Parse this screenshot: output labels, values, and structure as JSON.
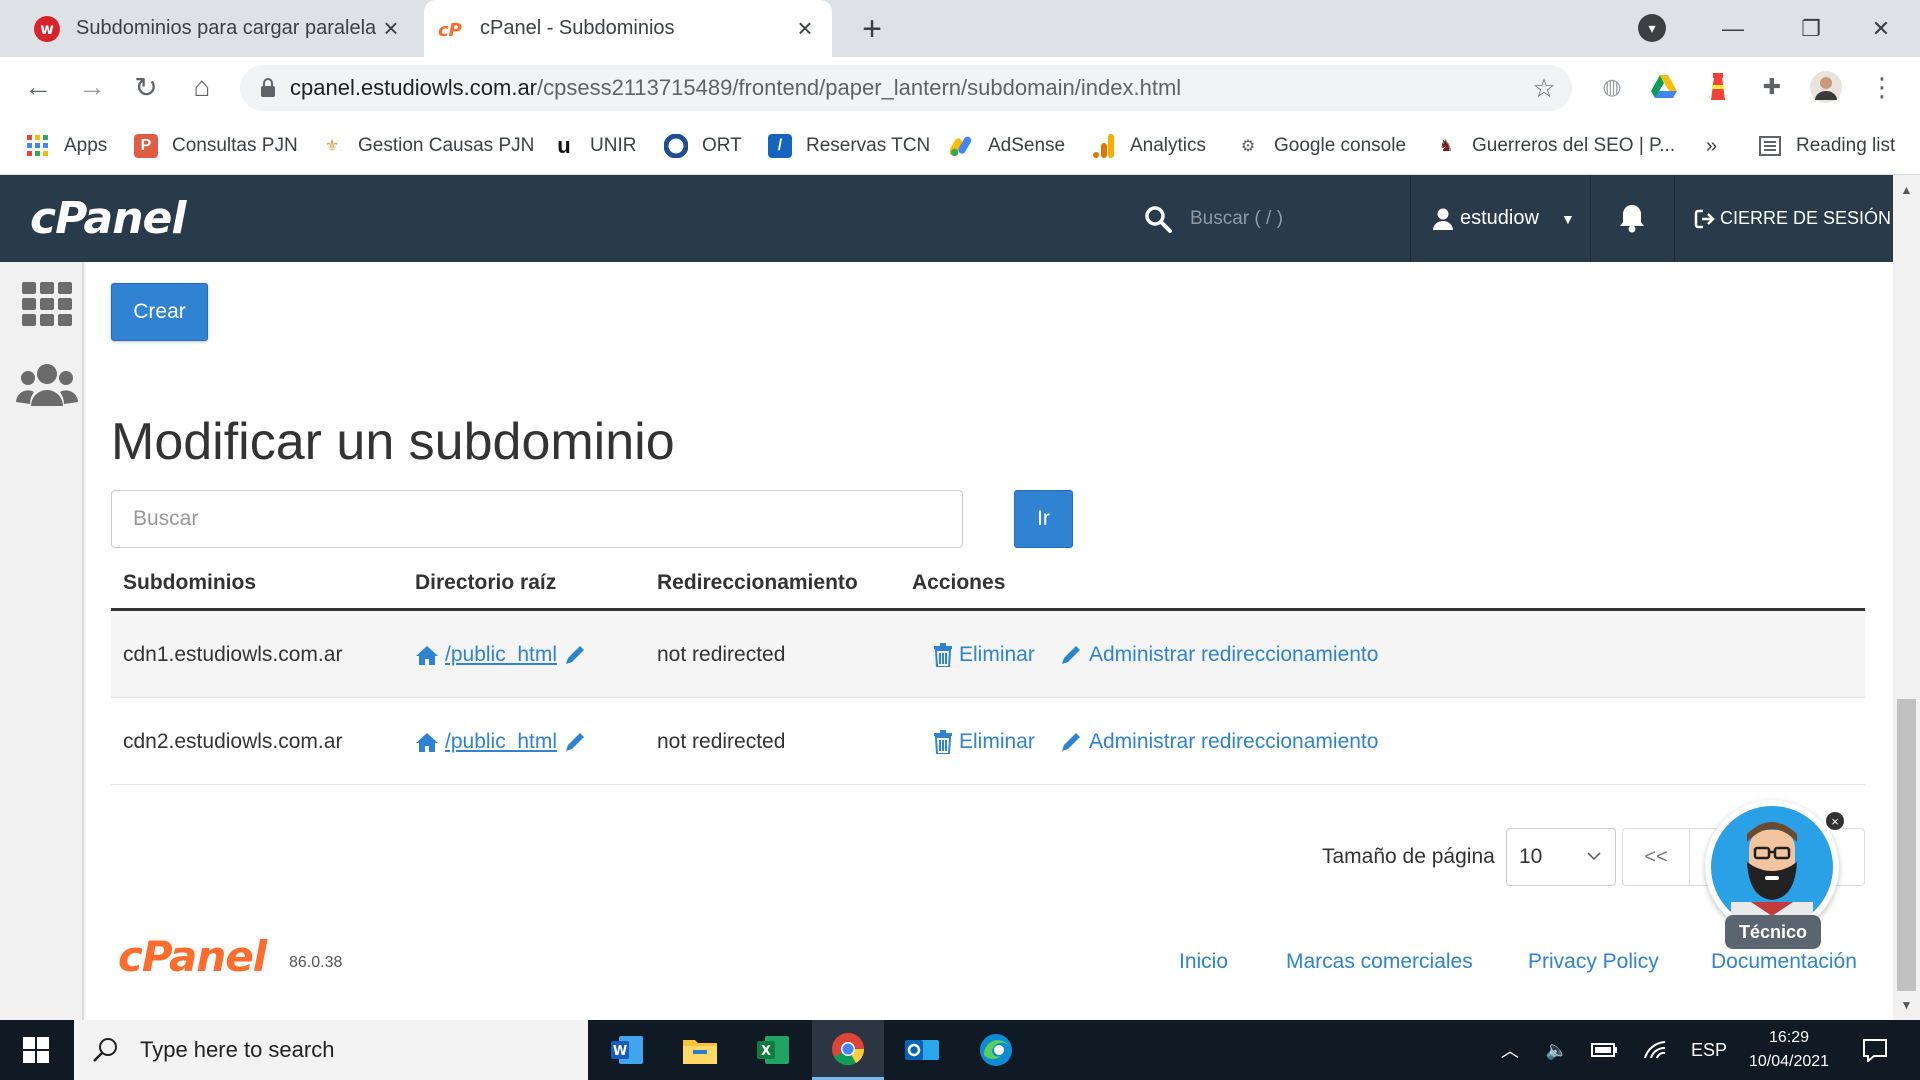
{
  "browser": {
    "tabs": [
      {
        "title": "Subdominios para cargar paralelam",
        "active": false
      },
      {
        "title": "cPanel - Subdominios",
        "active": true
      }
    ],
    "url_host": "cpanel.estudiowls.com.ar",
    "url_path": "/cpsess2113715489/frontend/paper_lantern/subdomain/index.html",
    "bookmarks": [
      {
        "label": "Apps",
        "icon": "apps-grid-icon"
      },
      {
        "label": "Consultas PJN",
        "icon": "pjn-icon"
      },
      {
        "label": "Gestion Causas PJN",
        "icon": "argentina-seal-icon"
      },
      {
        "label": "UNIR",
        "icon": "unir-icon"
      },
      {
        "label": "ORT",
        "icon": "ort-icon"
      },
      {
        "label": "Reservas TCN",
        "icon": "tcn-icon"
      },
      {
        "label": "AdSense",
        "icon": "adsense-icon"
      },
      {
        "label": "Analytics",
        "icon": "analytics-icon"
      },
      {
        "label": "Google console",
        "icon": "google-console-icon"
      },
      {
        "label": "Guerreros del SEO | P...",
        "icon": "guerreros-icon"
      }
    ],
    "bookmarks_overflow": "»",
    "reading_list": "Reading list"
  },
  "cpanel": {
    "logo": "cPanel",
    "search_placeholder": "Buscar ( / )",
    "user": "estudiow",
    "logout": "CIERRE DE SESIÓN"
  },
  "main": {
    "create_button": "Crear",
    "heading": "Modificar un subdominio",
    "search_placeholder": "Buscar",
    "go_button": "Ir",
    "table": {
      "headers": [
        "Subdominios",
        "Directorio raíz",
        "Redireccionamiento",
        "Acciones"
      ],
      "rows": [
        {
          "subdomain": "cdn1.estudiowls.com.ar",
          "root": "/public_html",
          "redirect": "not redirected",
          "delete": "Eliminar",
          "manage": "Administrar redireccionamiento"
        },
        {
          "subdomain": "cdn2.estudiowls.com.ar",
          "root": "/public_html",
          "redirect": "not redirected",
          "delete": "Eliminar",
          "manage": "Administrar redireccionamiento"
        }
      ]
    },
    "page_size_label": "Tamaño de página",
    "page_size_value": "10",
    "page_first": "<<"
  },
  "footer": {
    "logo": "cPanel",
    "version": "86.0.38",
    "links": [
      "Inicio",
      "Marcas comerciales",
      "Privacy Policy",
      "Documentación"
    ]
  },
  "assistant": {
    "label": "Técnico"
  },
  "taskbar": {
    "search_placeholder": "Type here to search",
    "language": "ESP",
    "time": "16:29",
    "date": "10/04/2021"
  },
  "colors": {
    "cpanel_header": "#293a4a",
    "primary_blue": "#2f83d2",
    "cpanel_orange": "#ff6c2c"
  }
}
